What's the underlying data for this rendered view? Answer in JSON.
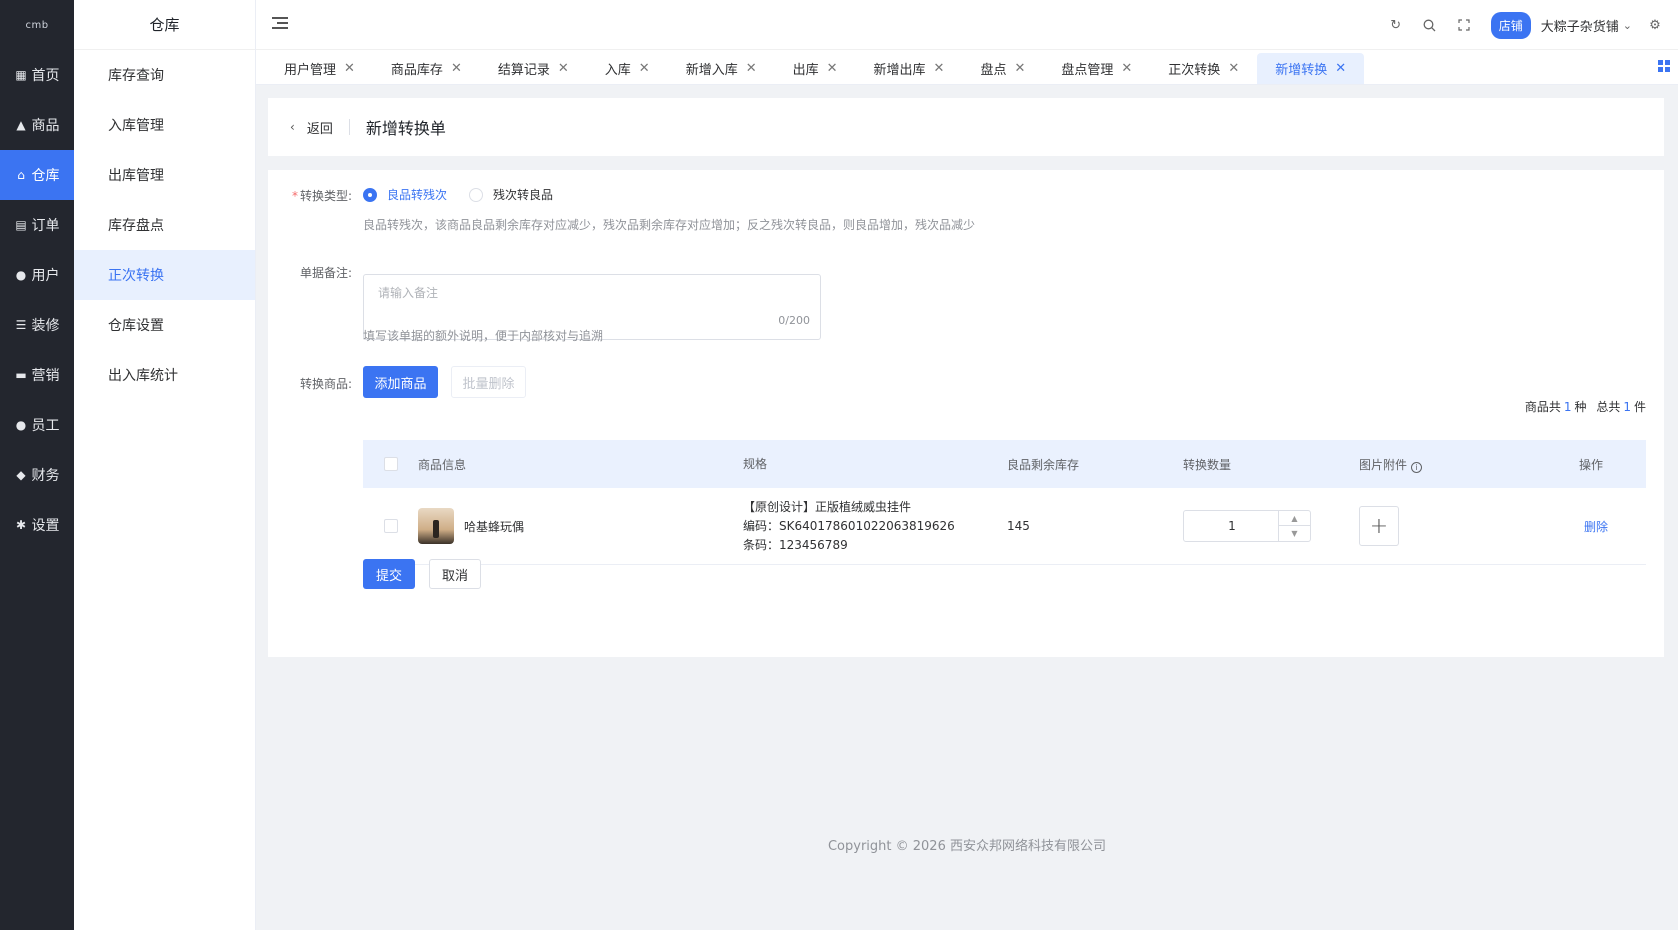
{
  "nav": {
    "logo": "cmb",
    "items": [
      {
        "label": "首页",
        "icon": "▦"
      },
      {
        "label": "商品",
        "icon": "▲"
      },
      {
        "label": "仓库",
        "icon": "⌂"
      },
      {
        "label": "订单",
        "icon": "▤"
      },
      {
        "label": "用户",
        "icon": "●"
      },
      {
        "label": "装修",
        "icon": "☰"
      },
      {
        "label": "营销",
        "icon": "▬"
      },
      {
        "label": "员工",
        "icon": "●"
      },
      {
        "label": "财务",
        "icon": "◆"
      },
      {
        "label": "设置",
        "icon": "✱"
      }
    ],
    "active_index": 2
  },
  "submenu": {
    "title": "仓库",
    "items": [
      "库存查询",
      "入库管理",
      "出库管理",
      "库存盘点",
      "正次转换",
      "仓库设置",
      "出入库统计"
    ],
    "active_index": 4
  },
  "header": {
    "shop_badge": "店铺",
    "shop_name": "大粽子杂货铺"
  },
  "tabs": [
    "用户管理",
    "商品库存",
    "结算记录",
    "入库",
    "新增入库",
    "出库",
    "新增出库",
    "盘点",
    "盘点管理",
    "正次转换",
    "新增转换"
  ],
  "active_tab": 10,
  "page": {
    "back_label": "返回",
    "title": "新增转换单"
  },
  "form": {
    "type_label": "转换类型:",
    "type_required_mark": "*",
    "options": [
      "良品转残次",
      "残次转良品"
    ],
    "selected_option": 0,
    "type_hint": "良品转残次，该商品良品剩余库存对应减少，残次品剩余库存对应增加；反之残次转良品，则良品增加，残次品减少",
    "remark_label": "单据备注:",
    "remark_placeholder": "请输入备注",
    "remark_counter": "0/200",
    "remark_hint": "填写该单据的额外说明，便于内部核对与追溯",
    "goods_label": "转换商品:",
    "add_button": "添加商品",
    "batch_delete_button": "批量删除",
    "summary": {
      "prefix": "商品共",
      "kinds": "1",
      "kinds_unit": "种",
      "total_prefix": "总共",
      "total": "1",
      "total_unit": "件"
    }
  },
  "table": {
    "headers": [
      "商品信息",
      "规格",
      "良品剩余库存",
      "转换数量",
      "图片附件",
      "操作"
    ],
    "rows": [
      {
        "name": "哈基蜂玩偶",
        "spec_line1": "【原创设计】正版植绒威虫挂件",
        "spec_line2": "编码：SK64017860102206381962​6",
        "spec_line3": "条码：123456789",
        "stock": "145",
        "quantity": "1",
        "upload_symbol": "+",
        "action": "删除"
      }
    ]
  },
  "actions": {
    "submit": "提交",
    "cancel": "取消"
  },
  "footer": "Copyright © 2026 西安众邦网络科技有限公司"
}
